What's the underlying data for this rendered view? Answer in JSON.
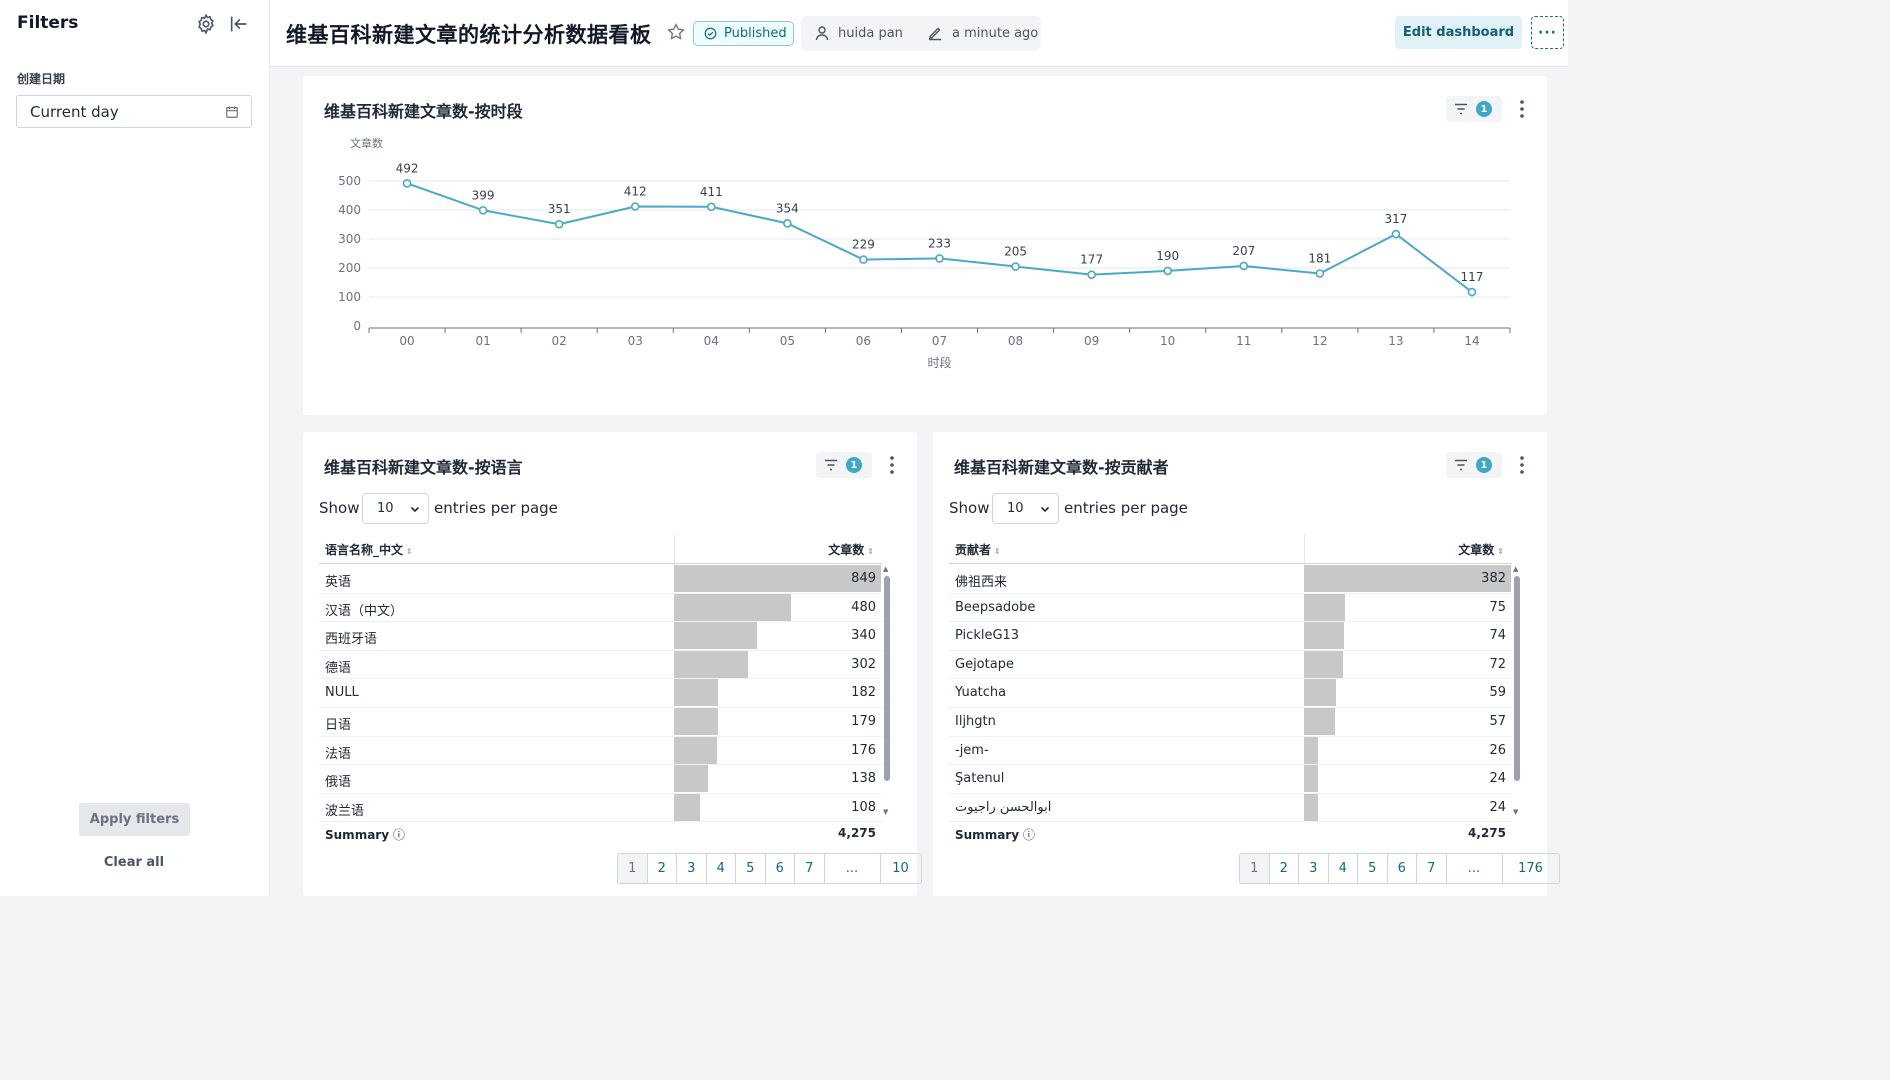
{
  "sidebar": {
    "title": "Filters",
    "filter_label": "创建日期",
    "filter_value": "Current day",
    "apply_label": "Apply filters",
    "clear_label": "Clear all"
  },
  "header": {
    "title": "维基百科新建文章的统计分析数据看板",
    "status": "Published",
    "owner": "huida pan",
    "modified": "a minute ago",
    "edit_label": "Edit dashboard",
    "more_label": "···"
  },
  "line_card": {
    "title": "维基百科新建文章数-按时段",
    "filter_count": "1"
  },
  "chart_data": {
    "type": "line",
    "title": "维基百科新建文章数-按时段",
    "xlabel": "时段",
    "ylabel": "文章数",
    "categories": [
      "00",
      "01",
      "02",
      "03",
      "04",
      "05",
      "06",
      "07",
      "08",
      "09",
      "10",
      "11",
      "12",
      "13",
      "14"
    ],
    "values": [
      492,
      399,
      351,
      412,
      411,
      354,
      229,
      233,
      205,
      177,
      190,
      207,
      181,
      317,
      117
    ],
    "yticks": [
      0,
      100,
      200,
      300,
      400,
      500
    ],
    "ylim": [
      0,
      500
    ],
    "color": "#4aa8c8",
    "grid": true
  },
  "lang_card": {
    "title": "维基百科新建文章数-按语言",
    "filter_count": "1",
    "show_label": "Show",
    "per_page": "10",
    "entries_label": "entries per page",
    "col_name": "语言名称_中文",
    "col_value": "文章数",
    "rows": [
      {
        "name": "英语",
        "value": "849",
        "n": 849
      },
      {
        "name": "汉语（中文）",
        "value": "480",
        "n": 480
      },
      {
        "name": "西班牙语",
        "value": "340",
        "n": 340
      },
      {
        "name": "德语",
        "value": "302",
        "n": 302
      },
      {
        "name": "NULL",
        "value": "182",
        "n": 182
      },
      {
        "name": "日语",
        "value": "179",
        "n": 179
      },
      {
        "name": "法语",
        "value": "176",
        "n": 176
      },
      {
        "name": "俄语",
        "value": "138",
        "n": 138
      },
      {
        "name": "波兰语",
        "value": "108",
        "n": 108
      }
    ],
    "summary_label": "Summary",
    "summary_value": "4,275",
    "pages": [
      "1",
      "2",
      "3",
      "4",
      "5",
      "6",
      "7",
      "...",
      "10"
    ]
  },
  "contrib_card": {
    "title": "维基百科新建文章数-按贡献者",
    "filter_count": "1",
    "show_label": "Show",
    "per_page": "10",
    "entries_label": "entries per page",
    "col_name": "贡献者",
    "col_value": "文章数",
    "rows": [
      {
        "name": "佛祖西来",
        "value": "382",
        "n": 382
      },
      {
        "name": "Beepsadobe",
        "value": "75",
        "n": 75
      },
      {
        "name": "PickleG13",
        "value": "74",
        "n": 74
      },
      {
        "name": "Gejotape",
        "value": "72",
        "n": 72
      },
      {
        "name": "Yuatcha",
        "value": "59",
        "n": 59
      },
      {
        "name": "Iljhgtn",
        "value": "57",
        "n": 57
      },
      {
        "name": "-jem-",
        "value": "26",
        "n": 26
      },
      {
        "name": "Şatenul",
        "value": "24",
        "n": 24
      },
      {
        "name": "ابوالحسن راجیوت",
        "value": "24",
        "n": 24
      }
    ],
    "summary_label": "Summary",
    "summary_value": "4,275",
    "pages": [
      "1",
      "2",
      "3",
      "4",
      "5",
      "6",
      "7",
      "...",
      "176"
    ]
  }
}
